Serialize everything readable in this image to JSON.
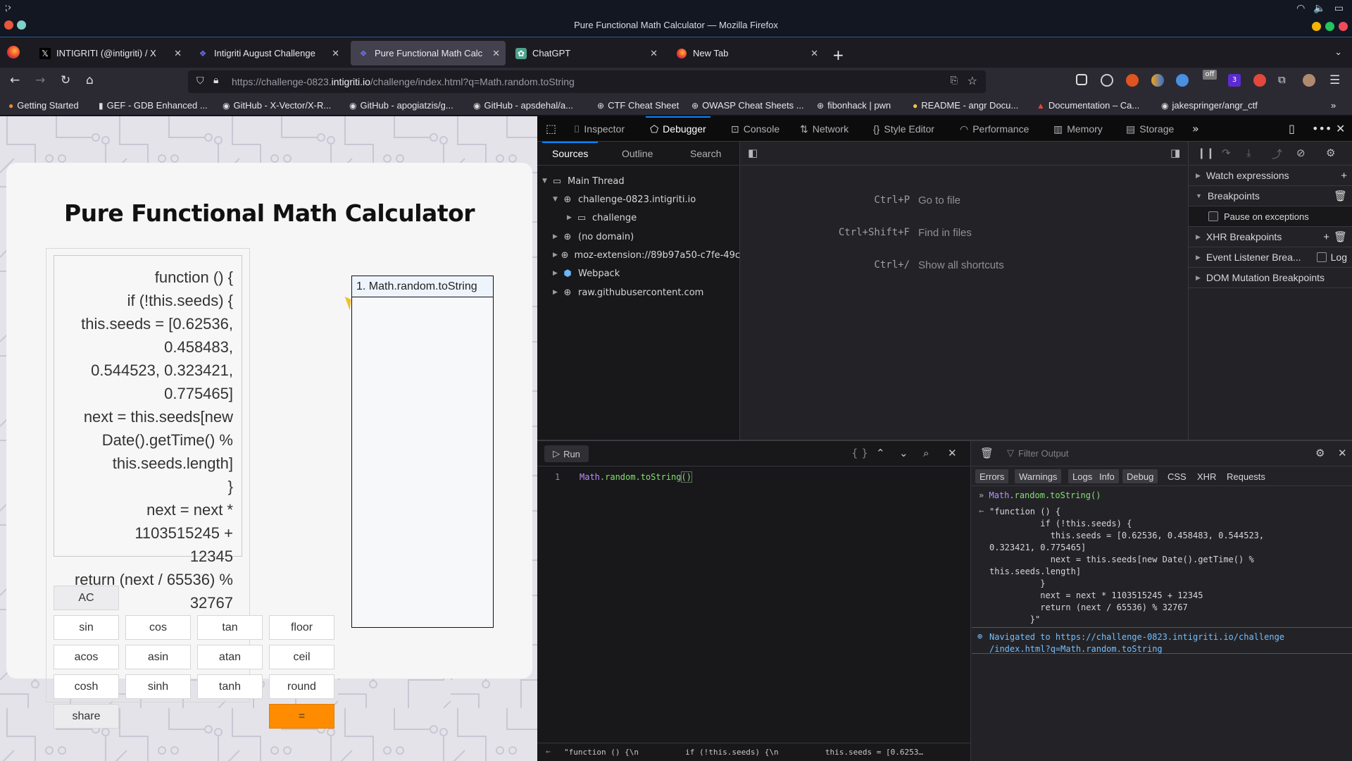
{
  "window": {
    "title": "Pure Functional Math Calculator — Mozilla Firefox"
  },
  "tabs": [
    {
      "label": "INTIGRITI (@intigriti) / X",
      "icon": "x-logo-icon",
      "active": false
    },
    {
      "label": "Intigriti August Challenge",
      "icon": "intigriti-icon",
      "active": false
    },
    {
      "label": "Pure Functional Math Calc",
      "icon": "intigriti-icon",
      "active": true
    },
    {
      "label": "ChatGPT",
      "icon": "chatgpt-icon",
      "active": false
    },
    {
      "label": "New Tab",
      "icon": "firefox-icon",
      "active": false
    }
  ],
  "navbar": {
    "url_prefix": "https://challenge-0823.",
    "url_domain": "intigriti.io",
    "url_suffix": "/challenge/index.html?q=Math.random.toString",
    "extension_badges": {
      "off": "off",
      "count": "3"
    }
  },
  "bookmarks": [
    {
      "label": "Getting Started",
      "icon": "firefox-icon"
    },
    {
      "label": "GEF - GDB Enhanced ...",
      "icon": "book-icon"
    },
    {
      "label": "GitHub - X-Vector/X-R...",
      "icon": "github-icon"
    },
    {
      "label": "GitHub - apogiatzis/g...",
      "icon": "github-icon"
    },
    {
      "label": "GitHub - apsdehal/a...",
      "icon": "github-icon"
    },
    {
      "label": "CTF Cheat Sheet",
      "icon": "globe-icon"
    },
    {
      "label": "OWASP Cheat Sheets ...",
      "icon": "globe-icon"
    },
    {
      "label": "fibonhack | pwn",
      "icon": "globe-icon"
    },
    {
      "label": "README - angr Docu...",
      "icon": "angr-icon"
    },
    {
      "label": "Documentation – Ca...",
      "icon": "warning-icon"
    },
    {
      "label": "jakespringer/angr_ctf",
      "icon": "github-icon"
    }
  ],
  "calculator": {
    "title": "Pure Functional Math Calculator",
    "display_lines": [
      "function () {",
      "if (!this.seeds) {",
      "this.seeds = [0.62536, 0.458483,",
      "0.544523, 0.323421, 0.775465]",
      "next = this.seeds[new",
      "Date().getTime() %",
      "this.seeds.length]",
      "}",
      "next = next * 1103515245 +",
      "12345",
      "return (next / 65536) % 32767",
      "}"
    ],
    "buttons": {
      "ac": "AC",
      "sin": "sin",
      "cos": "cos",
      "tan": "tan",
      "floor": "floor",
      "acos": "acos",
      "asin": "asin",
      "atan": "atan",
      "ceil": "ceil",
      "cosh": "cosh",
      "sinh": "sinh",
      "tanh": "tanh",
      "round": "round",
      "share": "share",
      "equals": "="
    },
    "history": [
      "1. Math.random.toString"
    ],
    "accent_color": "#ff8c00"
  },
  "devtools": {
    "tabs": [
      "Inspector",
      "Debugger",
      "Console",
      "Network",
      "Style Editor",
      "Performance",
      "Memory",
      "Storage"
    ],
    "active_tab": "Debugger",
    "sources_tabs": [
      "Sources",
      "Outline",
      "Search"
    ],
    "tree": [
      {
        "label": "Main Thread",
        "level": 0,
        "expanded": true,
        "icon": "window-icon"
      },
      {
        "label": "challenge-0823.intigriti.io",
        "level": 1,
        "expanded": true,
        "icon": "globe-icon"
      },
      {
        "label": "challenge",
        "level": 2,
        "expanded": false,
        "icon": "folder-icon"
      },
      {
        "label": "(no domain)",
        "level": 1,
        "expanded": false,
        "icon": "globe-icon"
      },
      {
        "label": "moz-extension://89b97a50-c7fe-49c",
        "level": 1,
        "expanded": false,
        "icon": "globe-icon"
      },
      {
        "label": "Webpack",
        "level": 1,
        "expanded": false,
        "icon": "webpack-icon"
      },
      {
        "label": "raw.githubusercontent.com",
        "level": 1,
        "expanded": false,
        "icon": "globe-icon"
      }
    ],
    "shortcuts": [
      {
        "key": "Ctrl+P",
        "desc": "Go to file"
      },
      {
        "key": "Ctrl+Shift+F",
        "desc": "Find in files"
      },
      {
        "key": "Ctrl+/",
        "desc": "Show all shortcuts"
      }
    ],
    "right_panel": {
      "watch": "Watch expressions",
      "breakpoints": "Breakpoints",
      "pause_exceptions": "Pause on exceptions",
      "xhr": "XHR Breakpoints",
      "event_listener": "Event Listener Brea...",
      "log": "Log",
      "dom_mutation": "DOM Mutation Breakpoints"
    },
    "editor_console": {
      "run_label": "Run",
      "line_number": "1",
      "code_obj": "Math",
      "code_prop": ".random.toString",
      "code_parens": "()",
      "status_preview": "\"function () {\\n          if (!this.seeds) {\\n          this.seeds = [0.6253…"
    },
    "console": {
      "filter_placeholder": "Filter Output",
      "filters": [
        "Errors",
        "Warnings",
        "Logs",
        "Info",
        "Debug",
        "CSS",
        "XHR",
        "Requests"
      ],
      "input_obj": "Math",
      "input_rest": ".random.toString()",
      "output": "\"function () {\n          if (!this.seeds) {\n            this.seeds = [0.62536, 0.458483, 0.544523,\n0.323421, 0.775465]\n            next = this.seeds[new Date().getTime() %\nthis.seeds.length]\n          }\n          next = next * 1103515245 + 12345\n          return (next / 65536) % 32767\n        }\"",
      "navigated": "Navigated to https://challenge-0823.intigriti.io/challenge\n/index.html?q=Math.random.toString"
    }
  }
}
